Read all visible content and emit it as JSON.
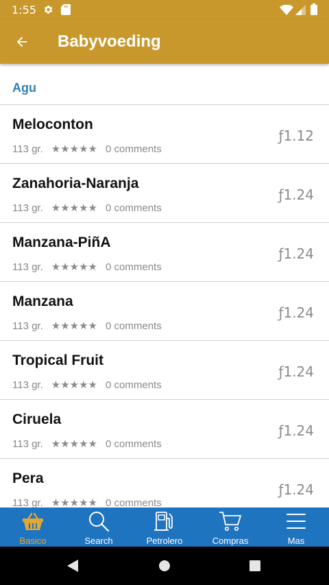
{
  "status_bar": {
    "time": "1:55"
  },
  "app_bar": {
    "title": "Babyvoeding"
  },
  "section": {
    "title": "Agu"
  },
  "products": [
    {
      "name": "Meloconton",
      "weight": "113 gr.",
      "rating": 5,
      "stars": "★★★★★",
      "comments": "0 comments",
      "price": "ƒ1.12"
    },
    {
      "name": "Zanahoria-Naranja",
      "weight": "113 gr.",
      "rating": 5,
      "stars": "★★★★★",
      "comments": "0 comments",
      "price": "ƒ1.24"
    },
    {
      "name": "Manzana-PiñA",
      "weight": "113 gr.",
      "rating": 5,
      "stars": "★★★★★",
      "comments": "0 comments",
      "price": "ƒ1.24"
    },
    {
      "name": "Manzana",
      "weight": "113 gr.",
      "rating": 5,
      "stars": "★★★★★",
      "comments": "0 comments",
      "price": "ƒ1.24"
    },
    {
      "name": "Tropical Fruit",
      "weight": "113 gr.",
      "rating": 5,
      "stars": "★★★★★",
      "comments": "0 comments",
      "price": "ƒ1.24"
    },
    {
      "name": "Ciruela",
      "weight": "113 gr.",
      "rating": 5,
      "stars": "★★★★★",
      "comments": "0 comments",
      "price": "ƒ1.24"
    },
    {
      "name": "Pera",
      "weight": "113 gr.",
      "rating": 5,
      "stars": "★★★★★",
      "comments": "0 comments",
      "price": "ƒ1.24"
    }
  ],
  "bottom_nav": [
    {
      "label": "Basico",
      "icon": "basket-icon",
      "active": true
    },
    {
      "label": "Search",
      "icon": "search-icon",
      "active": false
    },
    {
      "label": "Petrolero",
      "icon": "fuel-pump-icon",
      "active": false
    },
    {
      "label": "Compras",
      "icon": "cart-icon",
      "active": false
    },
    {
      "label": "Mas",
      "icon": "menu-icon",
      "active": false
    }
  ],
  "colors": {
    "app_bar": "#c8982c",
    "section_title": "#2e80b3",
    "bottom_nav": "#1f74c0",
    "nav_active": "#e0a734"
  }
}
